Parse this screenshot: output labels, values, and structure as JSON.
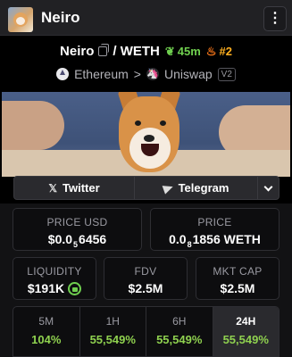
{
  "header": {
    "title": "Neiro",
    "menu_icon": "vertical-dots-icon"
  },
  "pair": {
    "base": "Neiro",
    "quote": "/ WETH",
    "age": "45m",
    "rank": "#2",
    "colors": {
      "age": "#6fcf4f",
      "rank": "#ffb020"
    }
  },
  "chain": {
    "network": "Ethereum",
    "separator": ">",
    "dex": "Uniswap",
    "version": "V2"
  },
  "social": {
    "twitter": "Twitter",
    "telegram": "Telegram"
  },
  "stats": {
    "price_usd": {
      "label": "PRICE USD",
      "prefix": "$0.0",
      "zeros": "5",
      "digits": "6456"
    },
    "price": {
      "label": "PRICE",
      "prefix": "0.0",
      "zeros": "8",
      "digits": "1856 WETH"
    },
    "liquidity": {
      "label": "LIQUIDITY",
      "value": "$191K"
    },
    "fdv": {
      "label": "FDV",
      "value": "$2.5M"
    },
    "mkt_cap": {
      "label": "MKT CAP",
      "value": "$2.5M"
    }
  },
  "timeframes": [
    {
      "label": "5M",
      "value": "104%"
    },
    {
      "label": "1H",
      "value": "55,549%"
    },
    {
      "label": "6H",
      "value": "55,549%"
    },
    {
      "label": "24H",
      "value": "55,549%"
    }
  ],
  "active_timeframe": "24H",
  "accent_positive": "#8fd14f"
}
